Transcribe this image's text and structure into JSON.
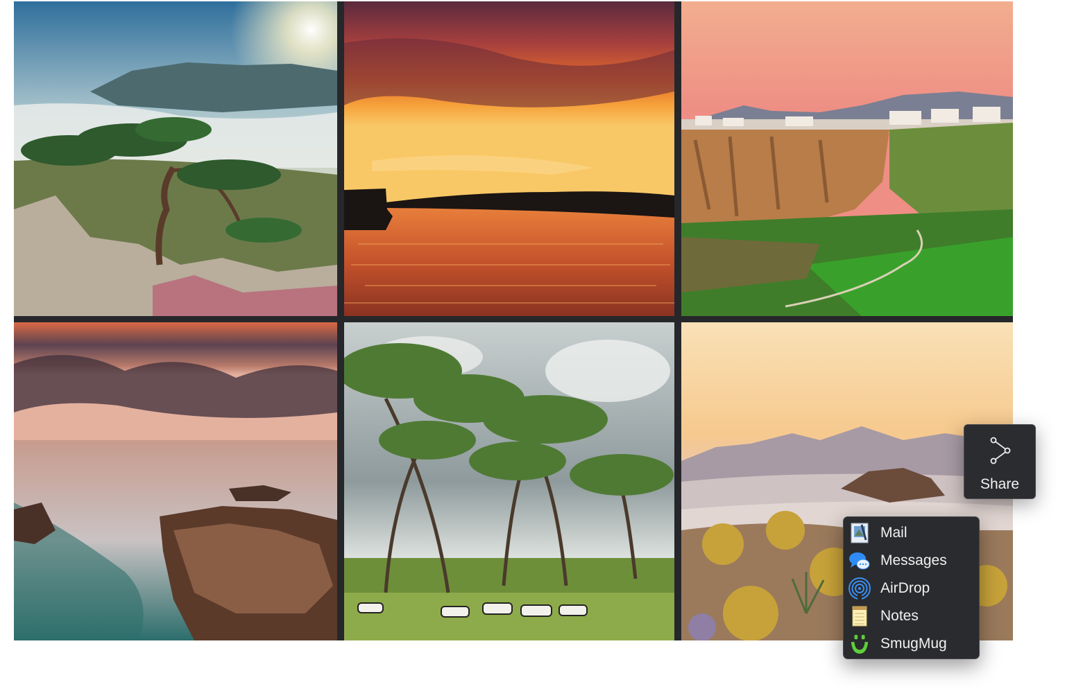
{
  "gallery": {
    "photos": [
      {
        "name": "Pine tree above clouds"
      },
      {
        "name": "Sunset over river"
      },
      {
        "name": "Cliff-top town"
      },
      {
        "name": "Rocky shore at dusk"
      },
      {
        "name": "Savanna with zebras"
      },
      {
        "name": "Desert mountains at sunset"
      }
    ]
  },
  "share_button": {
    "label": "Share",
    "icon": "share-icon"
  },
  "share_menu": {
    "items": [
      {
        "label": "Mail",
        "icon": "mail-icon"
      },
      {
        "label": "Messages",
        "icon": "messages-icon"
      },
      {
        "label": "AirDrop",
        "icon": "airdrop-icon"
      },
      {
        "label": "Notes",
        "icon": "notes-icon"
      },
      {
        "label": "SmugMug",
        "icon": "smugmug-icon"
      }
    ]
  },
  "colors": {
    "grid_background": "#26272a",
    "menu_background": "#2a2b2e",
    "menu_text": "#f1f1f1",
    "messages_blue": "#2f8cf7",
    "airdrop_blue": "#3a8ff3",
    "smugmug_green": "#5fcf3c"
  }
}
